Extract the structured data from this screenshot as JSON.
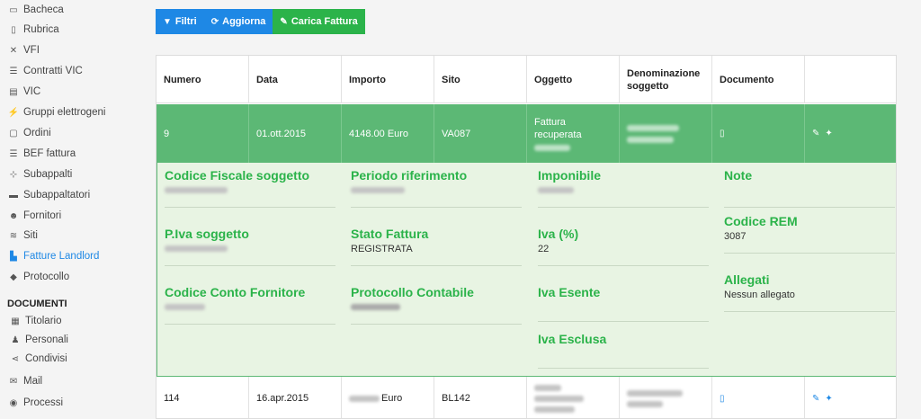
{
  "sidebar": {
    "items": [
      {
        "label": "Bacheca",
        "icon": "monitor-icon",
        "glyph": "▭"
      },
      {
        "label": "Rubrica",
        "icon": "book-icon",
        "glyph": "▯"
      },
      {
        "label": "VFI",
        "icon": "wrench-icon",
        "glyph": "✕"
      },
      {
        "label": "Contratti VIC",
        "icon": "list-icon",
        "glyph": "☰"
      },
      {
        "label": "VIC",
        "icon": "card-icon",
        "glyph": "▤"
      },
      {
        "label": "Gruppi elettrogeni",
        "icon": "plug-icon",
        "glyph": "⚡"
      },
      {
        "label": "Ordini",
        "icon": "box-icon",
        "glyph": "▢"
      },
      {
        "label": "BEF fattura",
        "icon": "list-icon",
        "glyph": "☰"
      },
      {
        "label": "Subappalti",
        "icon": "sitemap-icon",
        "glyph": "⊹"
      },
      {
        "label": "Subappaltatori",
        "icon": "briefcase-icon",
        "glyph": "▬"
      },
      {
        "label": "Fornitori",
        "icon": "users-icon",
        "glyph": "☻"
      },
      {
        "label": "Siti",
        "icon": "wifi-icon",
        "glyph": "≋"
      },
      {
        "label": "Fatture Landlord",
        "icon": "file-icon",
        "glyph": "▙"
      },
      {
        "label": "Protocollo",
        "icon": "tag-icon",
        "glyph": "◆"
      }
    ],
    "section_title": "DOCUMENTI",
    "doc_items": [
      {
        "label": "Titolario",
        "icon": "archive-icon",
        "glyph": "▦"
      },
      {
        "label": "Personali",
        "icon": "person-icon",
        "glyph": "♟"
      },
      {
        "label": "Condivisi",
        "icon": "share-icon",
        "glyph": "⋖"
      },
      {
        "label": "Mail",
        "icon": "envelope-icon",
        "glyph": "✉"
      },
      {
        "label": "Processi",
        "icon": "comments-icon",
        "glyph": "◉"
      }
    ],
    "active_color": "#1e88e5"
  },
  "toolbar": {
    "filter_label": "Filtri",
    "refresh_label": "Aggiorna",
    "upload_label": "Carica Fattura"
  },
  "table": {
    "headers": {
      "numero": "Numero",
      "data": "Data",
      "importo": "Importo",
      "sito": "Sito",
      "oggetto": "Oggetto",
      "denominazione": "Denominazione soggetto",
      "documento": "Documento"
    },
    "selected_row": {
      "numero": "9",
      "data": "01.ott.2015",
      "importo": "4148.00 Euro",
      "sito": "VA087",
      "oggetto": "Fattura recuperata"
    },
    "detail": {
      "codice_fiscale_label": "Codice Fiscale soggetto",
      "periodo_label": "Periodo riferimento",
      "imponibile_label": "Imponibile",
      "note_label": "Note",
      "piva_label": "P.Iva soggetto",
      "stato_label": "Stato Fattura",
      "stato_value": "REGISTRATA",
      "iva_label": "Iva (%)",
      "iva_value": "22",
      "rem_label": "Codice REM",
      "rem_value": "3087",
      "conto_label": "Codice Conto Fornitore",
      "protocollo_label": "Protocollo Contabile",
      "iva_esente_label": "Iva Esente",
      "allegati_label": "Allegati",
      "allegati_value": "Nessun allegato",
      "iva_esclusa_label": "Iva Esclusa"
    },
    "second_row": {
      "numero": "114",
      "data": "16.apr.2015",
      "importo_suffix": "Euro",
      "sito": "BL142"
    }
  },
  "colors": {
    "primary": "#1e88e5",
    "success": "#2bb34a",
    "selected_row": "#5cb875",
    "detail_bg": "#e8f4e3"
  }
}
